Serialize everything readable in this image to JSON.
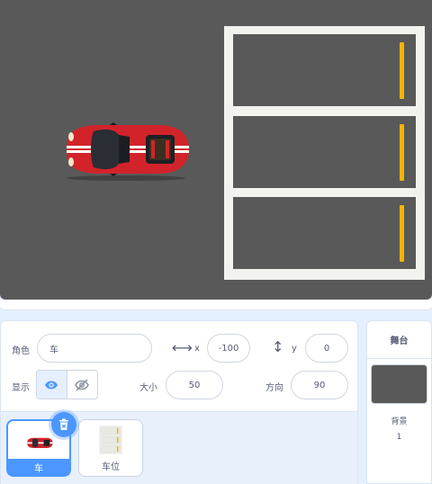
{
  "sprite_info": {
    "sprite_label": "角色",
    "sprite_name": "车",
    "x_label": "x",
    "x_value": "-100",
    "y_label": "y",
    "y_value": "0",
    "show_label": "显示",
    "size_label": "大小",
    "size_value": "50",
    "direction_label": "方向",
    "direction_value": "90"
  },
  "sprites": [
    {
      "name": "车",
      "selected": true
    },
    {
      "name": "车位",
      "selected": false
    }
  ],
  "stage_panel": {
    "title": "舞台",
    "backdrop_label": "背景",
    "backdrop_count": "1"
  },
  "icons": {
    "x_arrow": "horizontal-arrow-icon",
    "y_arrow": "vertical-arrow-icon",
    "show": "eye-icon",
    "hide": "eye-crossed-icon",
    "delete": "trash-icon"
  },
  "colors": {
    "accent": "#4c97ff",
    "stage_bg": "#595959",
    "parking_line": "#f5b400",
    "car_red": "#d2232a"
  }
}
